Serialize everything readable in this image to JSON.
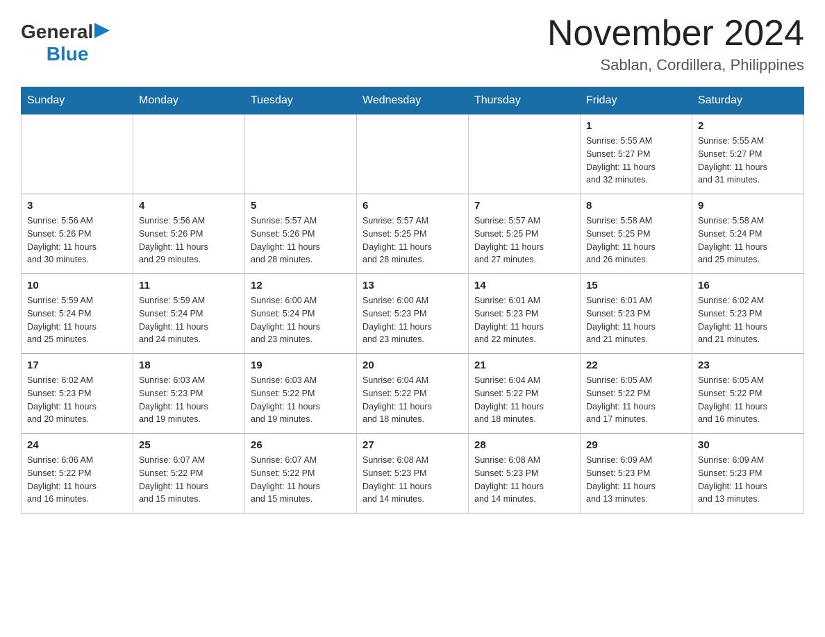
{
  "header": {
    "logo_general": "General",
    "logo_blue": "Blue",
    "title": "November 2024",
    "subtitle": "Sablan, Cordillera, Philippines"
  },
  "weekdays": [
    "Sunday",
    "Monday",
    "Tuesday",
    "Wednesday",
    "Thursday",
    "Friday",
    "Saturday"
  ],
  "weeks": [
    [
      {
        "day": "",
        "info": ""
      },
      {
        "day": "",
        "info": ""
      },
      {
        "day": "",
        "info": ""
      },
      {
        "day": "",
        "info": ""
      },
      {
        "day": "",
        "info": ""
      },
      {
        "day": "1",
        "info": "Sunrise: 5:55 AM\nSunset: 5:27 PM\nDaylight: 11 hours\nand 32 minutes."
      },
      {
        "day": "2",
        "info": "Sunrise: 5:55 AM\nSunset: 5:27 PM\nDaylight: 11 hours\nand 31 minutes."
      }
    ],
    [
      {
        "day": "3",
        "info": "Sunrise: 5:56 AM\nSunset: 5:26 PM\nDaylight: 11 hours\nand 30 minutes."
      },
      {
        "day": "4",
        "info": "Sunrise: 5:56 AM\nSunset: 5:26 PM\nDaylight: 11 hours\nand 29 minutes."
      },
      {
        "day": "5",
        "info": "Sunrise: 5:57 AM\nSunset: 5:26 PM\nDaylight: 11 hours\nand 28 minutes."
      },
      {
        "day": "6",
        "info": "Sunrise: 5:57 AM\nSunset: 5:25 PM\nDaylight: 11 hours\nand 28 minutes."
      },
      {
        "day": "7",
        "info": "Sunrise: 5:57 AM\nSunset: 5:25 PM\nDaylight: 11 hours\nand 27 minutes."
      },
      {
        "day": "8",
        "info": "Sunrise: 5:58 AM\nSunset: 5:25 PM\nDaylight: 11 hours\nand 26 minutes."
      },
      {
        "day": "9",
        "info": "Sunrise: 5:58 AM\nSunset: 5:24 PM\nDaylight: 11 hours\nand 25 minutes."
      }
    ],
    [
      {
        "day": "10",
        "info": "Sunrise: 5:59 AM\nSunset: 5:24 PM\nDaylight: 11 hours\nand 25 minutes."
      },
      {
        "day": "11",
        "info": "Sunrise: 5:59 AM\nSunset: 5:24 PM\nDaylight: 11 hours\nand 24 minutes."
      },
      {
        "day": "12",
        "info": "Sunrise: 6:00 AM\nSunset: 5:24 PM\nDaylight: 11 hours\nand 23 minutes."
      },
      {
        "day": "13",
        "info": "Sunrise: 6:00 AM\nSunset: 5:23 PM\nDaylight: 11 hours\nand 23 minutes."
      },
      {
        "day": "14",
        "info": "Sunrise: 6:01 AM\nSunset: 5:23 PM\nDaylight: 11 hours\nand 22 minutes."
      },
      {
        "day": "15",
        "info": "Sunrise: 6:01 AM\nSunset: 5:23 PM\nDaylight: 11 hours\nand 21 minutes."
      },
      {
        "day": "16",
        "info": "Sunrise: 6:02 AM\nSunset: 5:23 PM\nDaylight: 11 hours\nand 21 minutes."
      }
    ],
    [
      {
        "day": "17",
        "info": "Sunrise: 6:02 AM\nSunset: 5:23 PM\nDaylight: 11 hours\nand 20 minutes."
      },
      {
        "day": "18",
        "info": "Sunrise: 6:03 AM\nSunset: 5:23 PM\nDaylight: 11 hours\nand 19 minutes."
      },
      {
        "day": "19",
        "info": "Sunrise: 6:03 AM\nSunset: 5:22 PM\nDaylight: 11 hours\nand 19 minutes."
      },
      {
        "day": "20",
        "info": "Sunrise: 6:04 AM\nSunset: 5:22 PM\nDaylight: 11 hours\nand 18 minutes."
      },
      {
        "day": "21",
        "info": "Sunrise: 6:04 AM\nSunset: 5:22 PM\nDaylight: 11 hours\nand 18 minutes."
      },
      {
        "day": "22",
        "info": "Sunrise: 6:05 AM\nSunset: 5:22 PM\nDaylight: 11 hours\nand 17 minutes."
      },
      {
        "day": "23",
        "info": "Sunrise: 6:05 AM\nSunset: 5:22 PM\nDaylight: 11 hours\nand 16 minutes."
      }
    ],
    [
      {
        "day": "24",
        "info": "Sunrise: 6:06 AM\nSunset: 5:22 PM\nDaylight: 11 hours\nand 16 minutes."
      },
      {
        "day": "25",
        "info": "Sunrise: 6:07 AM\nSunset: 5:22 PM\nDaylight: 11 hours\nand 15 minutes."
      },
      {
        "day": "26",
        "info": "Sunrise: 6:07 AM\nSunset: 5:22 PM\nDaylight: 11 hours\nand 15 minutes."
      },
      {
        "day": "27",
        "info": "Sunrise: 6:08 AM\nSunset: 5:23 PM\nDaylight: 11 hours\nand 14 minutes."
      },
      {
        "day": "28",
        "info": "Sunrise: 6:08 AM\nSunset: 5:23 PM\nDaylight: 11 hours\nand 14 minutes."
      },
      {
        "day": "29",
        "info": "Sunrise: 6:09 AM\nSunset: 5:23 PM\nDaylight: 11 hours\nand 13 minutes."
      },
      {
        "day": "30",
        "info": "Sunrise: 6:09 AM\nSunset: 5:23 PM\nDaylight: 11 hours\nand 13 minutes."
      }
    ]
  ]
}
